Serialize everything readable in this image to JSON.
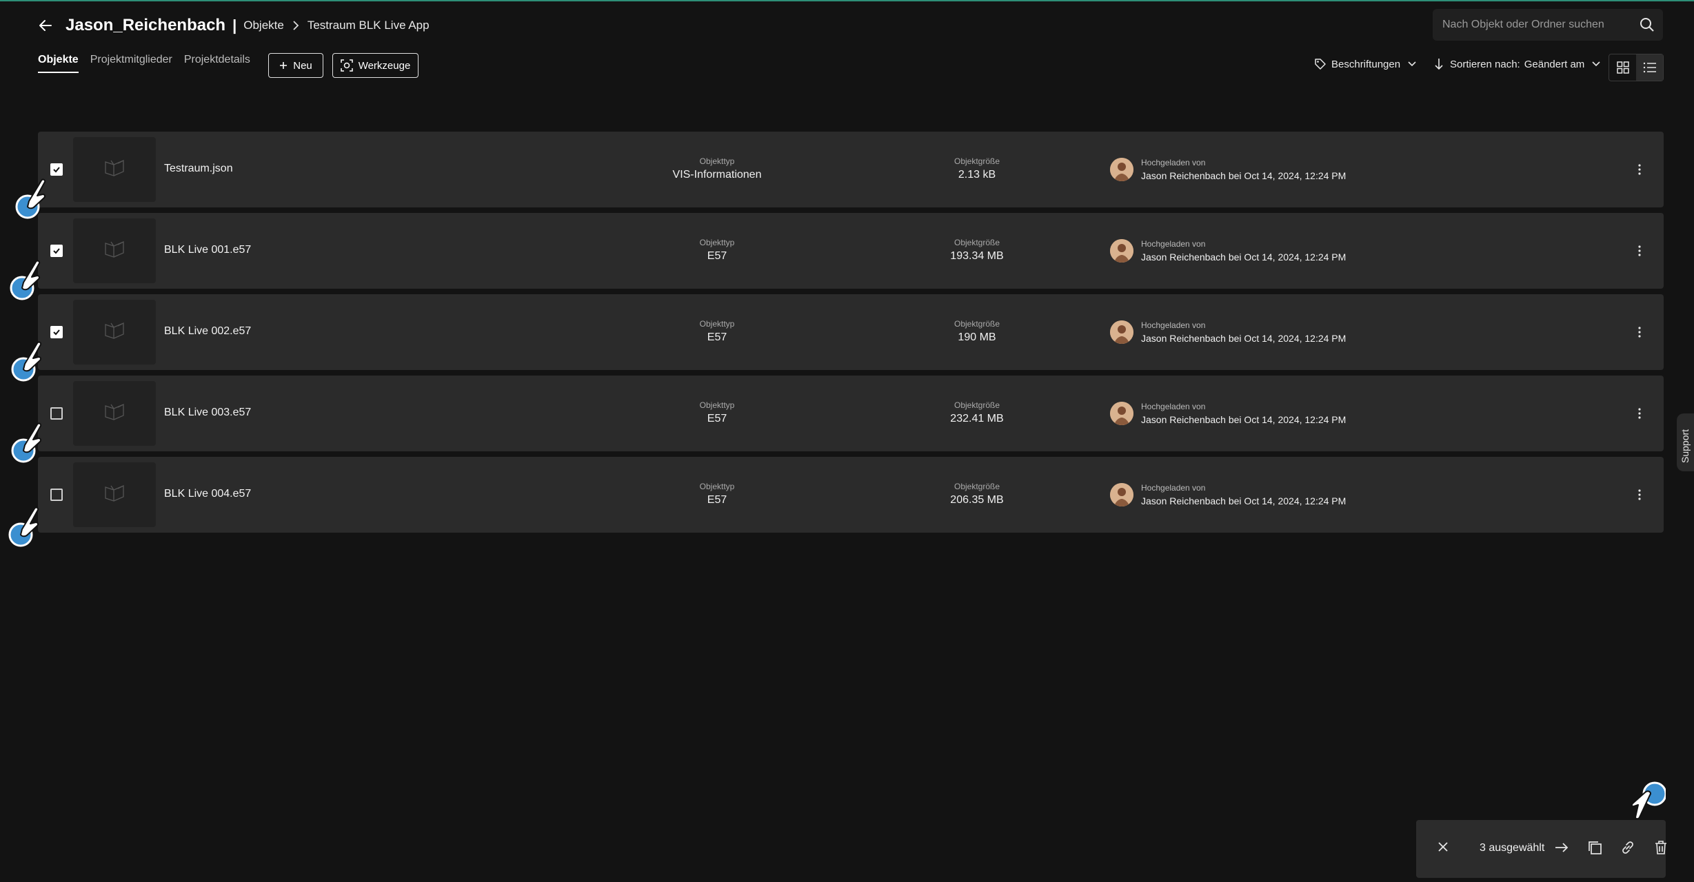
{
  "header": {
    "project_title": "Jason_Reichenbach",
    "separator": "|",
    "breadcrumb": [
      "Objekte",
      "Testraum BLK Live App"
    ]
  },
  "search": {
    "placeholder": "Nach Objekt oder Ordner suchen"
  },
  "tabs": [
    {
      "label": "Objekte",
      "active": true
    },
    {
      "label": "Projektmitglieder",
      "active": false
    },
    {
      "label": "Projektdetails",
      "active": false
    }
  ],
  "toolbar": {
    "new_label": "Neu",
    "tools_label": "Werkzeuge",
    "labels_label": "Beschriftungen",
    "sort_prefix": "Sortieren nach:",
    "sort_value": "Geändert am",
    "view_mode": "list"
  },
  "columns": {
    "type_label": "Objekttyp",
    "size_label": "Objektgröße",
    "uploaded_label": "Hochgeladen von"
  },
  "rows": [
    {
      "name": "Testraum.json",
      "type": "VIS-Informationen",
      "size": "2.13 kB",
      "uploaded_by": "Jason Reichenbach bei Oct 14, 2024, 12:24 PM",
      "checked": true
    },
    {
      "name": "BLK Live 001.e57",
      "type": "E57",
      "size": "193.34 MB",
      "uploaded_by": "Jason Reichenbach bei Oct 14, 2024, 12:24 PM",
      "checked": true
    },
    {
      "name": "BLK Live 002.e57",
      "type": "E57",
      "size": "190 MB",
      "uploaded_by": "Jason Reichenbach bei Oct 14, 2024, 12:24 PM",
      "checked": true
    },
    {
      "name": "BLK Live 003.e57",
      "type": "E57",
      "size": "232.41 MB",
      "uploaded_by": "Jason Reichenbach bei Oct 14, 2024, 12:24 PM",
      "checked": false
    },
    {
      "name": "BLK Live 004.e57",
      "type": "E57",
      "size": "206.35 MB",
      "uploaded_by": "Jason Reichenbach bei Oct 14, 2024, 12:24 PM",
      "checked": false
    }
  ],
  "support_label": "Support",
  "selection_bar": {
    "count_label": "3 ausgewählt"
  },
  "colors": {
    "accent_line": "#2e8f78",
    "background": "#131313",
    "row_bg": "#2b2b2b"
  }
}
